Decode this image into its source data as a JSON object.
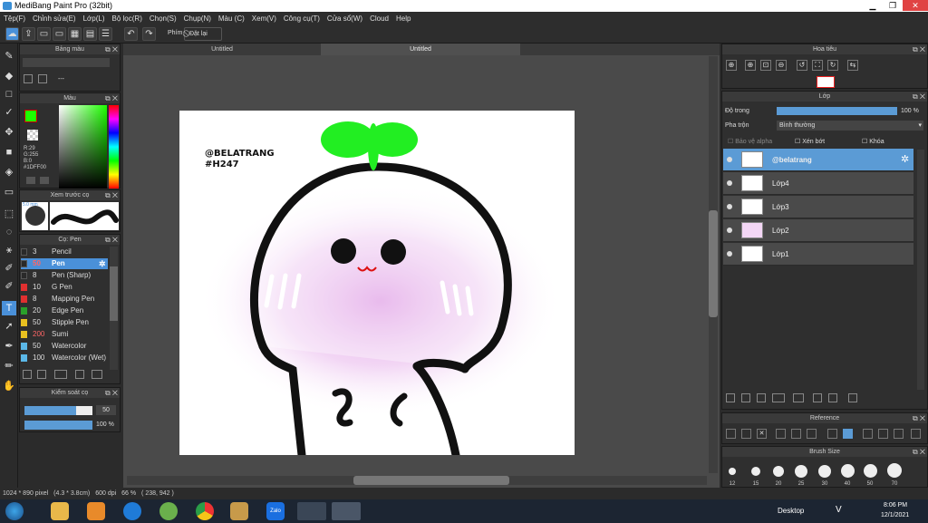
{
  "window": {
    "title": "MediBang Paint Pro (32bit)"
  },
  "menu": [
    "Tệp(F)",
    "Chỉnh sửa(E)",
    "Lớp(L)",
    "Bộ lọc(R)",
    "Chọn(S)",
    "Chụp(N)",
    "Màu (C)",
    "Xem(V)",
    "Công cụ(T)",
    "Cửa sổ(W)",
    "Cloud",
    "Help"
  ],
  "toolbar": {
    "phim_label": "Phím",
    "reset_label": "Đặt lại"
  },
  "tabs": [
    "Untitled",
    "Untitled"
  ],
  "panels": {
    "palette": {
      "title": "Bảng màu",
      "dash": "---"
    },
    "color": {
      "title": "Màu",
      "r": "R:29",
      "g": "G:255",
      "b": "B:0",
      "hex": "#1DFF00"
    },
    "preview": {
      "title": "Xem trước cọ",
      "size": "5.0 mm"
    },
    "brush": {
      "title": "Cọ: Pen"
    },
    "brush_control": {
      "title": "Kiểm soát cọ",
      "size_value": "50",
      "opacity_value": "100 %"
    },
    "navigator": {
      "title": "Hoa tiêu"
    },
    "layer": {
      "title": "Lớp",
      "opacity_label": "Độ trong",
      "opacity_value": "100 %",
      "blend_label": "Pha trộn",
      "blend_value": "Bình thường",
      "protect_alpha": "Bảo vệ alpha",
      "clip": "Xén bớt",
      "lock": "Khóa"
    },
    "reference": {
      "title": "Reference"
    },
    "brush_size": {
      "title": "Brush Size"
    }
  },
  "brushes": [
    {
      "size": "3",
      "name": "Pencil",
      "color": "#2a2a2a"
    },
    {
      "size": "50",
      "name": "Pen",
      "color": "#2a2a2a"
    },
    {
      "size": "8",
      "name": "Pen (Sharp)",
      "color": "#2a2a2a"
    },
    {
      "size": "10",
      "name": "G Pen",
      "color": "#e03030"
    },
    {
      "size": "8",
      "name": "Mapping Pen",
      "color": "#e03030"
    },
    {
      "size": "20",
      "name": "Edge Pen",
      "color": "#2aa02a"
    },
    {
      "size": "50",
      "name": "Stipple Pen",
      "color": "#e8c020"
    },
    {
      "size": "200",
      "name": "Sumi",
      "color": "#e8c020"
    },
    {
      "size": "50",
      "name": "Watercolor",
      "color": "#5bb8e8"
    },
    {
      "size": "100",
      "name": "Watercolor (Wet)",
      "color": "#5bb8e8"
    }
  ],
  "layers": [
    "@belatrang",
    "Lớp4",
    "Lớp3",
    "Lớp2",
    "Lớp1"
  ],
  "brush_sizes": [
    "12",
    "15",
    "20",
    "25",
    "30",
    "40",
    "50",
    "70"
  ],
  "canvas_text": {
    "line1": "@BELATRANG",
    "line2": "#H247"
  },
  "status": {
    "dims": "1024 * 890 pixel",
    "cm": "(4.3 * 3.8cm)",
    "dpi": "600 dpi",
    "zoom": "66 %",
    "coords": "( 238, 942 )"
  },
  "taskbar": {
    "desktop": "Desktop",
    "time": "8:06 PM",
    "date": "12/1/2021",
    "lang": "V"
  },
  "colors": {
    "accent": "#4a90d9",
    "fg": "#1dff00",
    "selected_layer": "#5b9bd5"
  }
}
